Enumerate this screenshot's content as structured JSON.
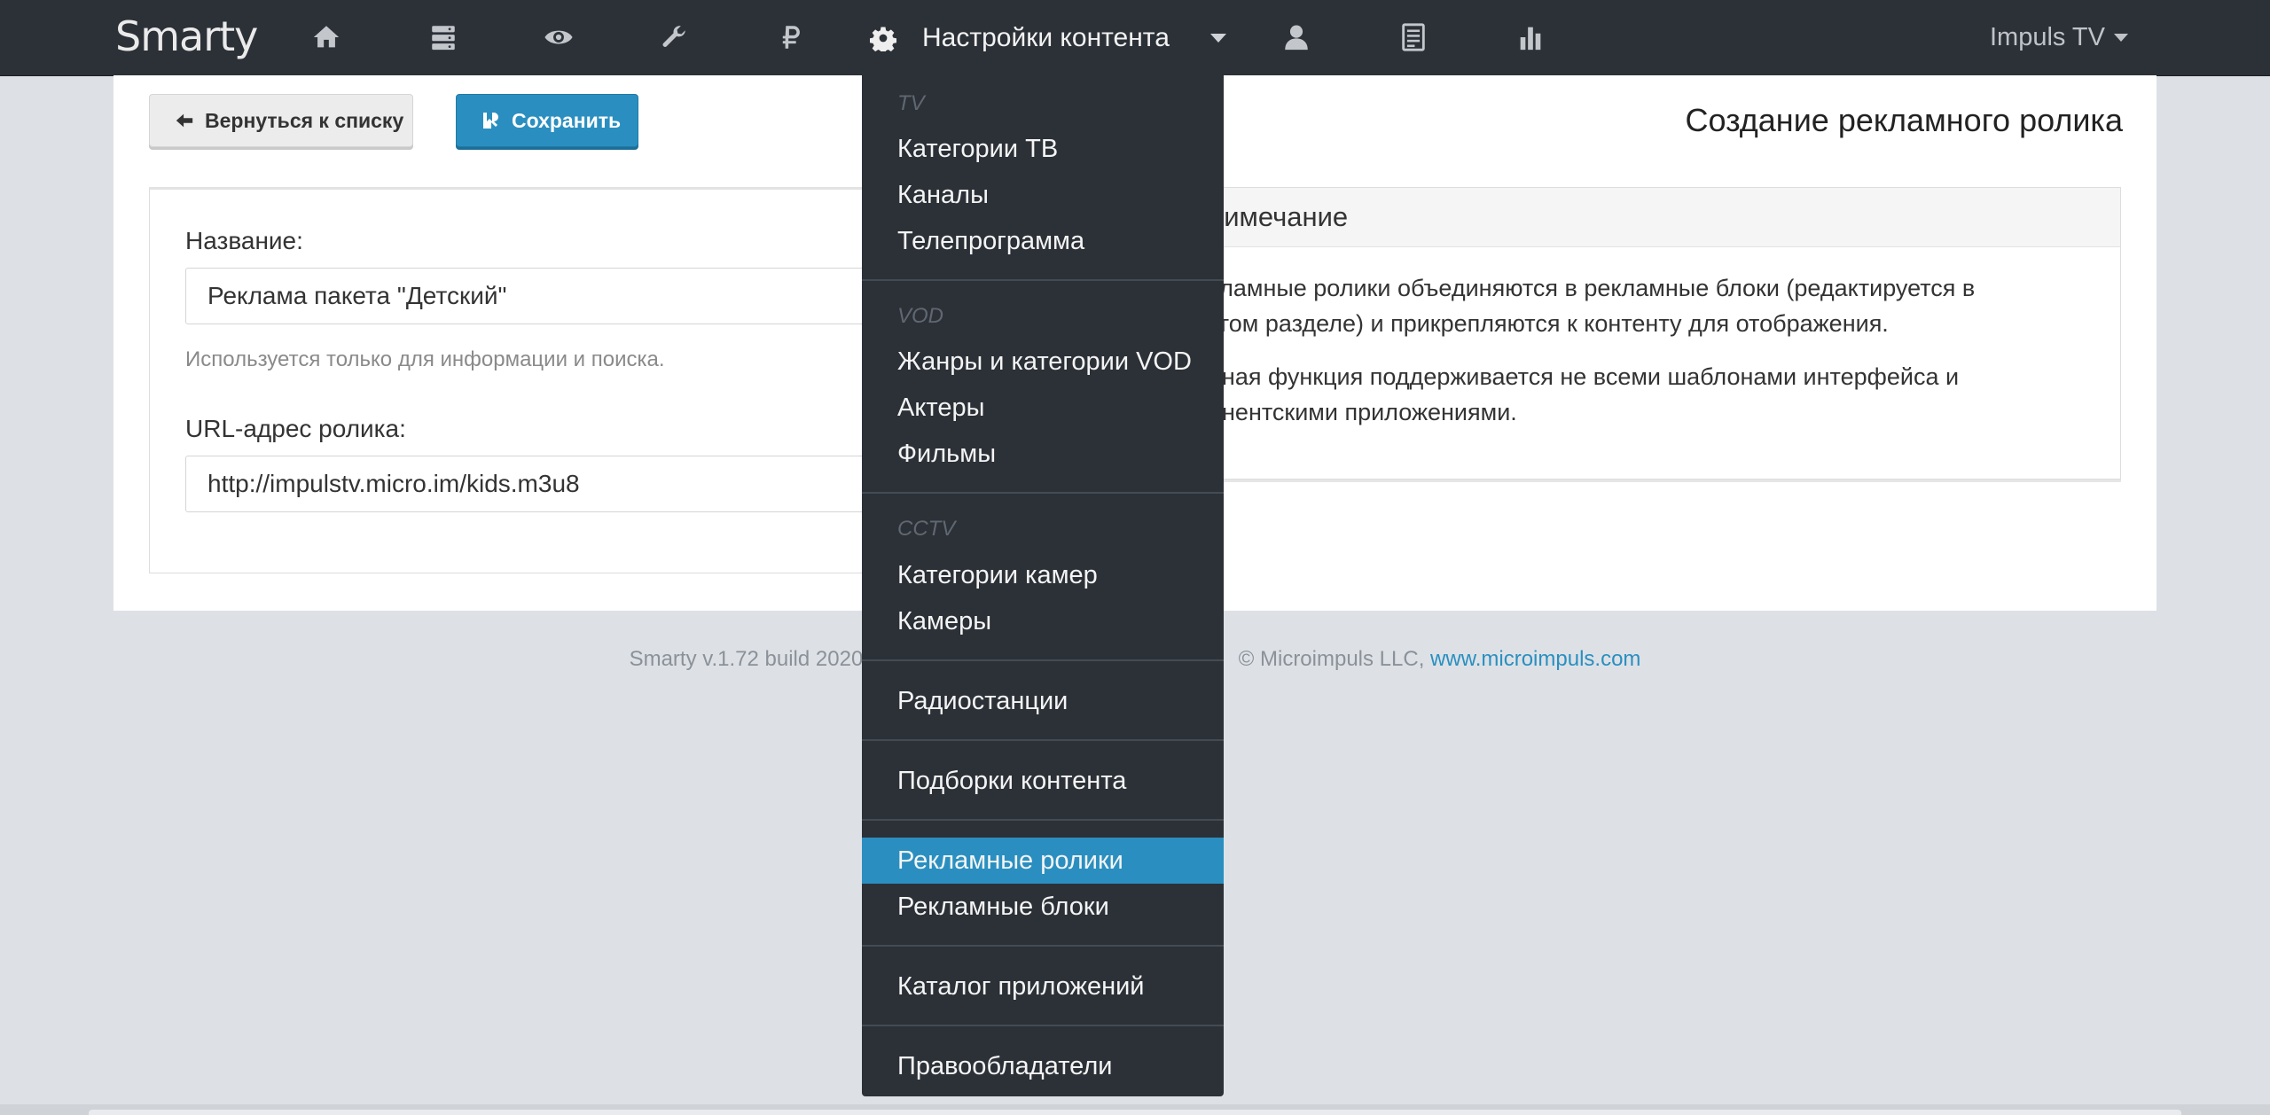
{
  "navbar": {
    "brand": "Smarty",
    "icons": [
      "home-icon",
      "server-icon",
      "eye-icon",
      "wrench-icon",
      "ruble-icon",
      "user-icon",
      "report-icon",
      "bar-chart-icon"
    ],
    "content_menu_label": "Настройки контента",
    "user_label": "Impuls TV"
  },
  "toolbar": {
    "back_label": "Вернуться к списку",
    "save_label": "Сохранить"
  },
  "page_title": "Создание рекламного ролика",
  "form": {
    "name_label": "Название:",
    "name_value": "Реклама пакета \"Детский\"",
    "name_help": "Используется только для информации и поиска.",
    "url_label": "URL-адрес ролика:",
    "url_value": "http://impulstv.micro.im/kids.m3u8"
  },
  "note": {
    "title": "римечание",
    "para1_line1": "кламные ролики объединяются в рекламные блоки (редактируется в",
    "para1_line2": "угом разделе) и прикрепляются к контенту для отображения.",
    "para2_line1": "нная функция поддерживается не всеми шаблонами интерфейса и",
    "para2_line2": "онентскими приложениями."
  },
  "footer": {
    "left": "Smarty v.1.72 build 2020",
    "right": "© Microimpuls LLC,",
    "link": "www.microimpuls.com"
  },
  "dropdown": {
    "tv_header": "TV",
    "tv_items": [
      "Категории ТВ",
      "Каналы",
      "Телепрограмма"
    ],
    "vod_header": "VOD",
    "vod_items": [
      "Жанры и категории VOD",
      "Актеры",
      "Фильмы"
    ],
    "cctv_header": "CCTV",
    "cctv_items": [
      "Категории камер",
      "Камеры"
    ],
    "radio": "Радиостанции",
    "collections": "Подборки контента",
    "ads_items": [
      "Рекламные ролики",
      "Рекламные блоки"
    ],
    "app_catalog": "Каталог приложений",
    "rights_holders": "Правообладатели",
    "active_item": "Рекламные ролики"
  },
  "colors": {
    "navbar_bg": "#2c3138",
    "accent": "#2a8fc0",
    "page_bg": "#dde1e6"
  }
}
